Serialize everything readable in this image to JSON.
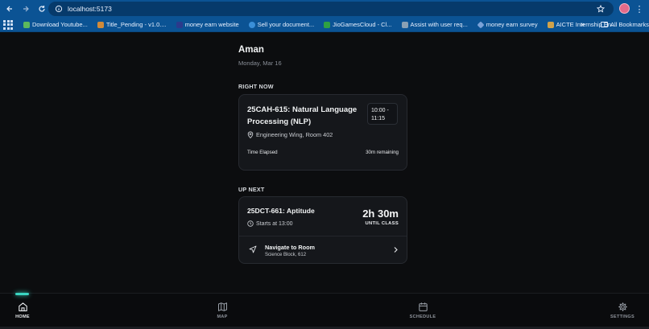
{
  "browser": {
    "url": "localhost:5173",
    "bookmarks": [
      {
        "label": "Download Youtube...",
        "color": "#5cb85c"
      },
      {
        "label": "Title_Pending - v1.0....",
        "color": "#d08a3a"
      },
      {
        "label": "money earn website",
        "color": "#2b3a8c"
      },
      {
        "label": "Sell your document...",
        "color": "#3a8fd8"
      },
      {
        "label": "JioGamesCloud - Cl...",
        "color": "#2ea043"
      },
      {
        "label": "Assist with user req...",
        "color": "#8aa0b4"
      },
      {
        "label": "money earn survey",
        "color": "#7aa2d8"
      },
      {
        "label": "AICTE Internship En...",
        "color": "#d0a24a"
      }
    ],
    "all_bookmarks": "All Bookmarks"
  },
  "header": {
    "name": "Aman",
    "date": "Monday, Mar 16"
  },
  "right_now": {
    "section_label": "RIGHT NOW",
    "course_title": "25CAH-615: Natural Language Processing (NLP)",
    "time_start": "10:00 -",
    "time_end": "11:15",
    "location": "Engineering Wing, Room 402",
    "elapsed_label": "Time Elapsed",
    "remaining": "30m remaining"
  },
  "up_next": {
    "section_label": "UP NEXT",
    "course_title": "25DCT-661: Aptitude",
    "starts": "Starts at 13:00",
    "countdown": "2h 30m",
    "until_label": "UNTIL CLASS",
    "navigate_title": "Navigate to Room",
    "navigate_sub": "Science Block, 612"
  },
  "bottom_nav": {
    "tabs": [
      {
        "label": "HOME",
        "icon": "home-icon",
        "active": true
      },
      {
        "label": "MAP",
        "icon": "map-icon",
        "active": false
      },
      {
        "label": "SCHEDULE",
        "icon": "calendar-icon",
        "active": false
      },
      {
        "label": "SETTINGS",
        "icon": "gear-icon",
        "active": false
      }
    ],
    "accent": "#3ad5c1"
  }
}
